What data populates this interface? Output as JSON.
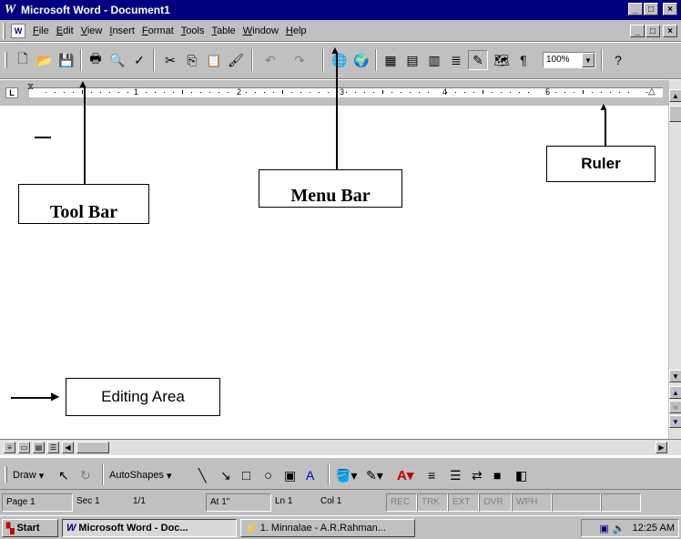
{
  "window": {
    "app_icon": "word-icon",
    "title": "Microsoft Word - Document1",
    "min_label": "_",
    "max_label": "□",
    "close_label": "×",
    "doc_min_label": "_",
    "doc_restore_label": "□",
    "doc_close_label": "×"
  },
  "menubar": {
    "items": [
      "File",
      "Edit",
      "View",
      "Insert",
      "Format",
      "Tools",
      "Table",
      "Window",
      "Help"
    ]
  },
  "toolbar": {
    "zoom": "100%",
    "buttons": [
      "new-icon",
      "open-icon",
      "save-icon",
      "print-icon",
      "print-preview-icon",
      "spelling-icon",
      "cut-icon",
      "copy-icon",
      "paste-icon",
      "format-painter-icon",
      "undo-icon",
      "redo-icon",
      "hyperlink-icon",
      "web-toolbar-icon",
      "tables-borders-icon",
      "insert-table-icon",
      "insert-excel-icon",
      "columns-icon",
      "drawing-icon",
      "document-map-icon",
      "show-hide-icon"
    ]
  },
  "ruler": {
    "tab_marker": "L",
    "numbers": [
      "1",
      "2",
      "3",
      "4",
      "5"
    ]
  },
  "annotations": {
    "toolbar_label": "Tool Bar",
    "menubar_label": "Menu Bar",
    "ruler_label": "Ruler",
    "editing_label": "Editing Area"
  },
  "drawbar": {
    "draw_label": "Draw",
    "autoshapes_label": "AutoShapes"
  },
  "statusbar": {
    "page": "Page 1",
    "sec": "Sec 1",
    "pages": "1/1",
    "at": "At 1\"",
    "ln": "Ln 1",
    "col": "Col 1",
    "rec": "REC",
    "trk": "TRK",
    "ext": "EXT",
    "ovr": "OVR",
    "wph": "WPH"
  },
  "taskbar": {
    "start_label": "Start",
    "task1": "Microsoft Word - Doc...",
    "task2": "1. Minnalae - A.R.Rahman...",
    "clock": "12:25 AM"
  }
}
